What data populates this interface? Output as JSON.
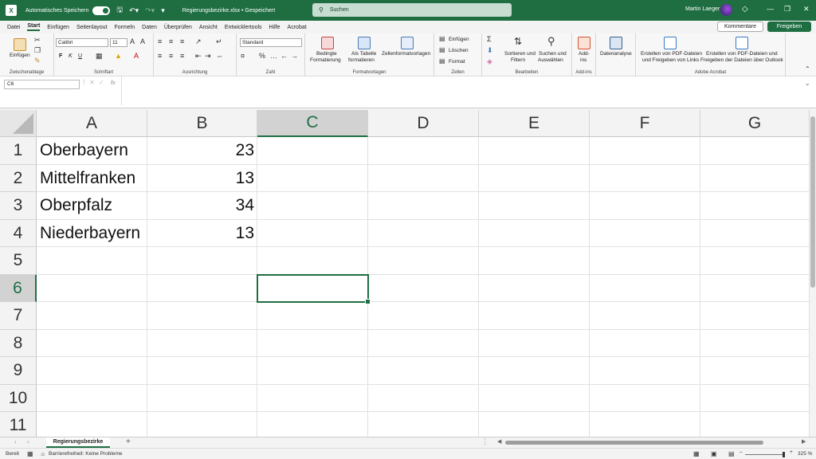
{
  "titlebar": {
    "app_icon": "X",
    "autosave_label": "Automatisches Speichern",
    "doc_title": "Regierungsbezirke.xlsx • Gespeichert",
    "search_placeholder": "Suchen",
    "user_name": "Martin Laeger"
  },
  "menu": {
    "tabs": [
      "Datei",
      "Start",
      "Einfügen",
      "Seitenlayout",
      "Formeln",
      "Daten",
      "Überprüfen",
      "Ansicht",
      "Entwicklertools",
      "Hilfe",
      "Acrobat"
    ],
    "active": "Start",
    "comments_label": "Kommentare",
    "share_label": "Freigeben"
  },
  "ribbon": {
    "clipboard": {
      "label": "Zwischenablage",
      "paste": "Einfügen"
    },
    "font": {
      "label": "Schriftart",
      "family": "Calibri",
      "size": "11",
      "bold": "F",
      "italic": "K",
      "underline": "U"
    },
    "alignment": {
      "label": "Ausrichtung"
    },
    "number": {
      "label": "Zahl",
      "format": "Standard"
    },
    "styles": {
      "label": "Formatvorlagen",
      "conditional_1": "Bedingte",
      "conditional_2": "Formatierung",
      "table_1": "Als Tabelle",
      "table_2": "formatieren",
      "cellstyles": "Zellenformatvorlagen"
    },
    "cells": {
      "label": "Zellen",
      "insert": "Einfügen",
      "delete": "Löschen",
      "format": "Format"
    },
    "editing": {
      "label": "Bearbeiten",
      "sort_1": "Sortieren und",
      "sort_2": "Filtern",
      "find_1": "Suchen und",
      "find_2": "Auswählen"
    },
    "addins": {
      "label": "Add-ins",
      "addins_1": "Add-",
      "addins_2": "ins",
      "analysis": "Datenanalyse"
    },
    "acrobat": {
      "label": "Adobe Acrobat",
      "pdf1_1": "Erstellen von PDF-Dateien",
      "pdf1_2": "und Freigeben von Links",
      "pdf2_1": "Erstellen von PDF-Dateien und",
      "pdf2_2": "Freigeben der Dateien über Outlook"
    }
  },
  "formula": {
    "namebox": "C6",
    "fx": "fx",
    "content": ""
  },
  "sheet": {
    "columns": [
      "A",
      "B",
      "C",
      "D",
      "E",
      "F",
      "G"
    ],
    "selected_column": "C",
    "rows": [
      "1",
      "2",
      "3",
      "4",
      "5",
      "6",
      "7",
      "8",
      "9",
      "10",
      "11"
    ],
    "selected_row": "6",
    "cells": {
      "A1": "Oberbayern",
      "B1": "23",
      "A2": "Mittelfranken",
      "B2": "13",
      "A3": "Oberpfalz",
      "B3": "34",
      "A4": "Niederbayern",
      "B4": "13"
    }
  },
  "sheet_tabs": {
    "active": "Regierungsbezirke",
    "add": "+"
  },
  "status": {
    "ready": "Bereit",
    "accessibility": "Barrierefreiheit: Keine Probleme",
    "zoom": "325 %"
  }
}
